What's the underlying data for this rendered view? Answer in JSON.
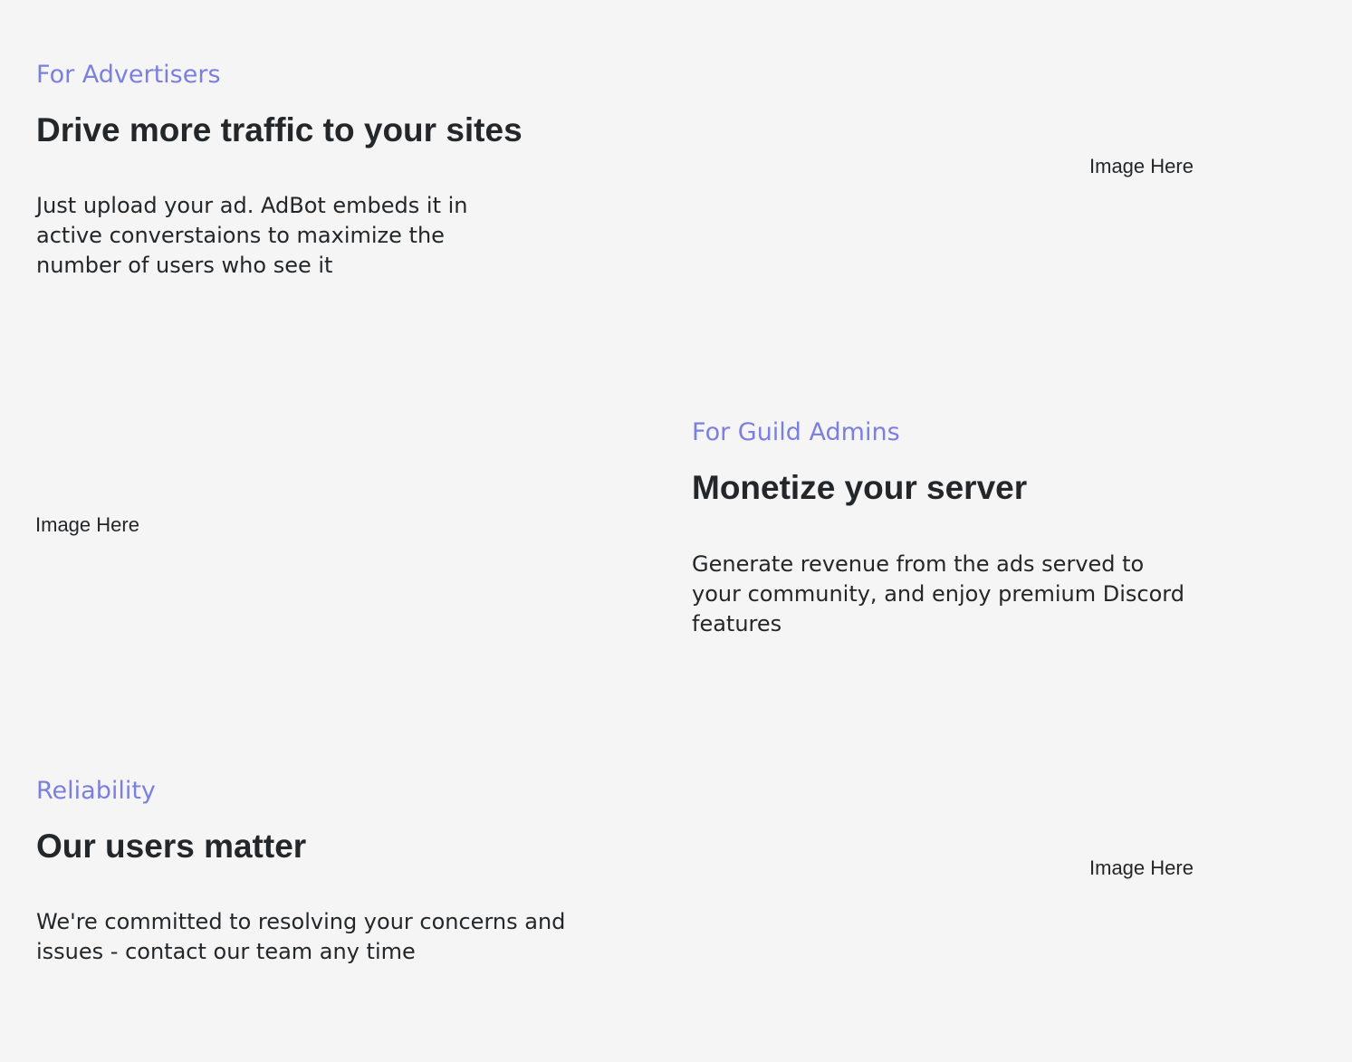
{
  "sections": [
    {
      "eyebrow": "For Advertisers",
      "title": "Drive more traffic to your sites",
      "description": "Just upload your ad. AdBot embeds it in active converstaions to maximize the number of users who see it",
      "image_placeholder": "Image Here"
    },
    {
      "eyebrow": "For Guild Admins",
      "title": "Monetize your server",
      "description": "Generate revenue from the ads served to your community, and enjoy premium Discord features",
      "image_placeholder": "Image Here"
    },
    {
      "eyebrow": "Reliability",
      "title": "Our users matter",
      "description": "We're committed to resolving your concerns and issues - contact our team any time",
      "image_placeholder": "Image Here"
    }
  ],
  "colors": {
    "background": "#f5f5f5",
    "accent": "#7b7fe0",
    "text": "#23272a"
  }
}
